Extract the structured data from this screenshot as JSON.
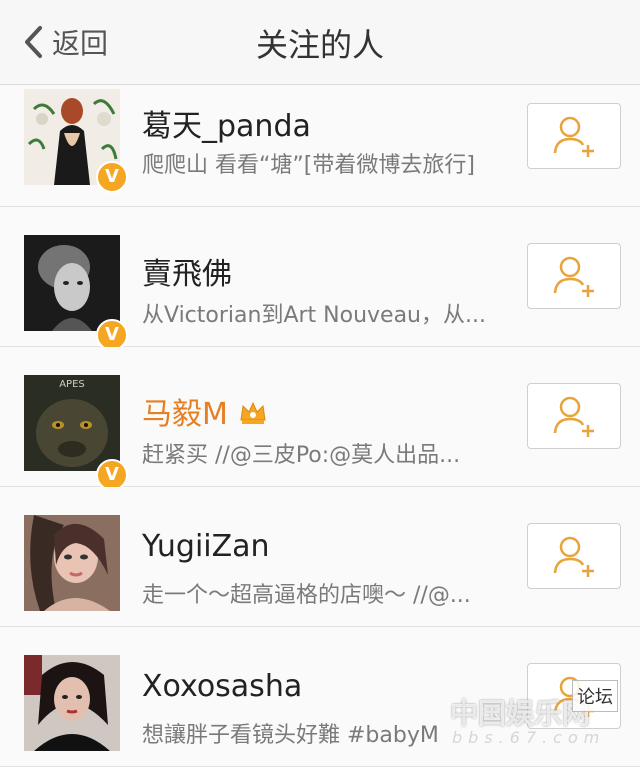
{
  "header": {
    "back_label": "返回",
    "title": "关注的人"
  },
  "users": [
    {
      "name": "葛天_panda",
      "desc": "爬爬山 看看“塘”[带着微博去旅行]",
      "verified": "V",
      "vip": false
    },
    {
      "name": "賣飛佛",
      "desc": "从Victorian到Art Nouveau，从...",
      "verified": "V",
      "vip": false
    },
    {
      "name": "马毅M",
      "desc": "赶紧买 //@三皮Po:@莫人出品...",
      "verified": "V",
      "vip": true
    },
    {
      "name": "YugiiZan",
      "desc": "走一个～超高逼格的店噢～ //@...",
      "verified": "",
      "vip": false
    },
    {
      "name": "Xoxosasha",
      "desc": "想讓胖子看镜头好難  #babyM",
      "verified": "",
      "vip": false
    }
  ],
  "avatar_texts": {
    "apes": "APES"
  },
  "watermark": {
    "site_cn": "中国娱乐网",
    "site_url": "bbs.67.com",
    "forum": "论坛"
  },
  "colors": {
    "accent": "#f5a623",
    "vip_name": "#e67e22",
    "text": "#222222",
    "subtext": "#7a7a7a"
  },
  "icons": {
    "back": "chevron-left-icon",
    "follow": "add-user-icon",
    "verified": "verified-badge-icon",
    "vip": "crown-icon"
  }
}
